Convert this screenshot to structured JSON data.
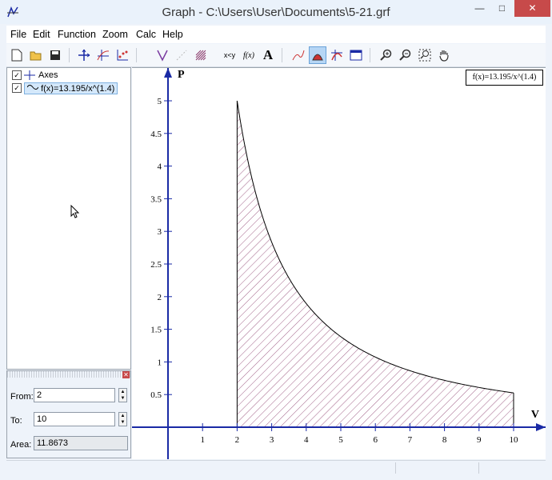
{
  "window": {
    "title": "Graph - C:\\Users\\User\\Documents\\5-21.grf"
  },
  "menu": {
    "items": [
      "File",
      "Edit",
      "Function",
      "Zoom",
      "Calc",
      "Help"
    ]
  },
  "toolbar": {
    "icons": [
      "new-file-icon",
      "open-folder-icon",
      "save-icon",
      "axes-icon",
      "insert-function-icon",
      "insert-point-series-icon",
      "insert-tangent-icon",
      "insert-relation-icon",
      "insert-shading-icon",
      "evaluate-icon",
      "function-f-icon",
      "insert-label-icon",
      "insert-trendline-icon",
      "area-icon",
      "calc-table-icon",
      "table-icon",
      "zoom-in-icon",
      "zoom-out-icon",
      "zoom-window-icon",
      "pan-hand-icon"
    ],
    "xy_label": "x<y",
    "fx_label": "f(x)",
    "text_label": "A"
  },
  "tree": {
    "axes_label": "Axes",
    "function_label": "f(x)=13.195/x^(1.4)"
  },
  "area_panel": {
    "from_label": "From:",
    "from_value": "2",
    "to_label": "To:",
    "to_value": "10",
    "area_label": "Area:",
    "area_value": "11.8673"
  },
  "graph": {
    "legend_text": "f(x)=13.195/x^(1.4)",
    "x_axis_label": "V",
    "y_axis_label": "P"
  },
  "chart_data": {
    "type": "area",
    "function": "f(x)=13.195/x^(1.4)",
    "coefficient": 13.195,
    "exponent": 1.4,
    "shade_from": 2,
    "shade_to": 10,
    "xlim": [
      -1,
      11
    ],
    "ylim": [
      -0.5,
      5.5
    ],
    "x_ticks": [
      1,
      2,
      3,
      4,
      5,
      6,
      7,
      8,
      9,
      10
    ],
    "y_ticks": [
      0.5,
      1,
      1.5,
      2,
      2.5,
      3,
      3.5,
      4,
      4.5,
      5
    ],
    "xlabel": "V",
    "ylabel": "P",
    "area": 11.8673,
    "colors": {
      "axis": "#1a2aa5",
      "curve": "#000000",
      "shading": "#8a3b6b"
    }
  }
}
